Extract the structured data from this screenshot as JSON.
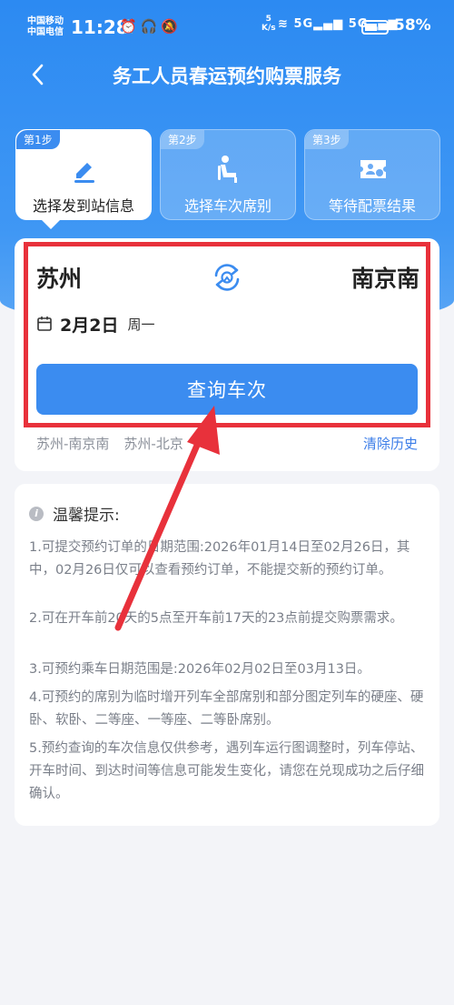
{
  "status_bar": {
    "carrier_1": "中国移动",
    "carrier_2": "中国电信",
    "time": "11:28",
    "net_speed_top": "5",
    "net_speed_bottom": "K/s",
    "signal_1": "5G",
    "signal_2": "5G",
    "battery_percent": "58%",
    "battery_level": 0.58
  },
  "nav": {
    "title": "务工人员春运预约购票服务"
  },
  "steps": [
    {
      "tag": "第1步",
      "label": "选择发到站信息",
      "icon": "edit-icon",
      "active": true
    },
    {
      "tag": "第2步",
      "label": "选择车次席别",
      "icon": "seat-icon",
      "active": false
    },
    {
      "tag": "第3步",
      "label": "等待配票结果",
      "icon": "ticket-icon",
      "active": false
    }
  ],
  "search": {
    "from_station": "苏州",
    "to_station": "南京南",
    "date": "2月2日",
    "weekday": "周一",
    "query_button": "查询车次"
  },
  "history": {
    "items": [
      "苏州-南京南",
      "苏州-北京"
    ],
    "clear_label": "清除历史"
  },
  "tips": {
    "title": "温馨提示:",
    "items": [
      "1.可提交预约订单的日期范围:2026年01月14日至02月26日，其中，02月26日仅可以查看预约订单，不能提交新的预约订单。",
      "2.可在开车前20天的5点至开车前17天的23点前提交购票需求。",
      "3.可预约乘车日期范围是:2026年02月02日至03月13日。",
      "4.可预约的席别为临时增开列车全部席别和部分图定列车的硬座、硬卧、软卧、二等座、一等座、二等卧席别。",
      "5.预约查询的车次信息仅供参考，遇列车运行图调整时，列车停站、开车时间、到达时间等信息可能发生变化，请您在兑现成功之后仔细确认。"
    ]
  },
  "colors": {
    "primary": "#3b8cf0",
    "header_gradient_top": "#2c8af2",
    "highlight_box": "#e8313b",
    "annotation_arrow": "#e8313b",
    "link": "#3b7de8"
  }
}
